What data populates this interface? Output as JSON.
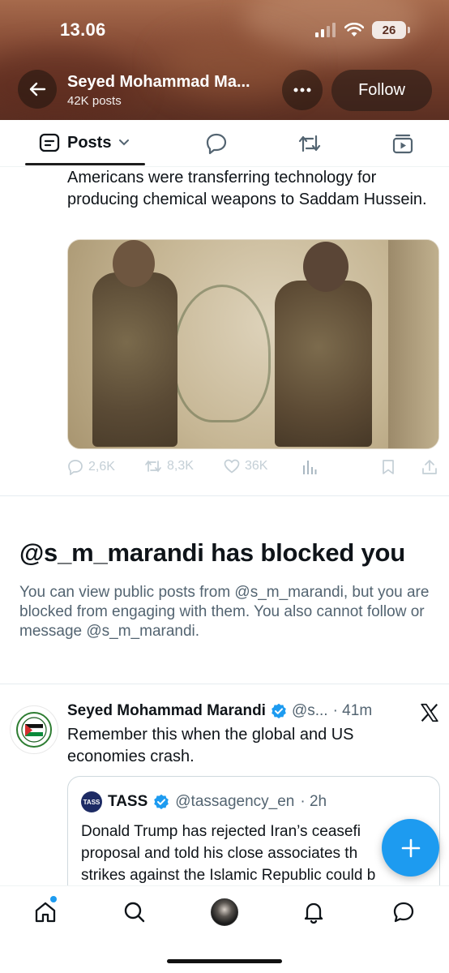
{
  "status_bar": {
    "time": "13.06",
    "battery": "26"
  },
  "header": {
    "title": "Seyed Mohammad Ma...",
    "subtitle": "42K posts",
    "follow_label": "Follow",
    "more_label": "•••"
  },
  "tabs": {
    "posts_label": "Posts",
    "icons": [
      "replies-icon",
      "reposts-icon",
      "media-icon"
    ]
  },
  "tweet1": {
    "text": "Americans were transferring technology for producing chemical weapons to Saddam Hussein.",
    "replies": "2,6K",
    "reposts": "8,3K",
    "likes": "36K"
  },
  "blocked": {
    "title": "@s_m_marandi has blocked you",
    "body": "You can view public posts from @s_m_marandi, but you are blocked from engaging with them. You also cannot follow or message @s_m_marandi."
  },
  "tweet2": {
    "name": "Seyed Mohammad Marandi",
    "handle": "@s...",
    "time": "· 41m",
    "text": "Remember this when the global and US economies crash.",
    "quote": {
      "logo": "TASS",
      "name": "TASS",
      "handle": "@tassagency_en",
      "time": "· 2h",
      "lines": [
        "Donald Trump has rejected Iran’s ceasefi",
        "proposal and told his close associates th",
        "strikes against the Islamic Republic could b"
      ]
    }
  },
  "colors": {
    "accent": "#1d9bf0",
    "text": "#0f1419",
    "muted": "#536471",
    "banner": "#7a4431"
  }
}
